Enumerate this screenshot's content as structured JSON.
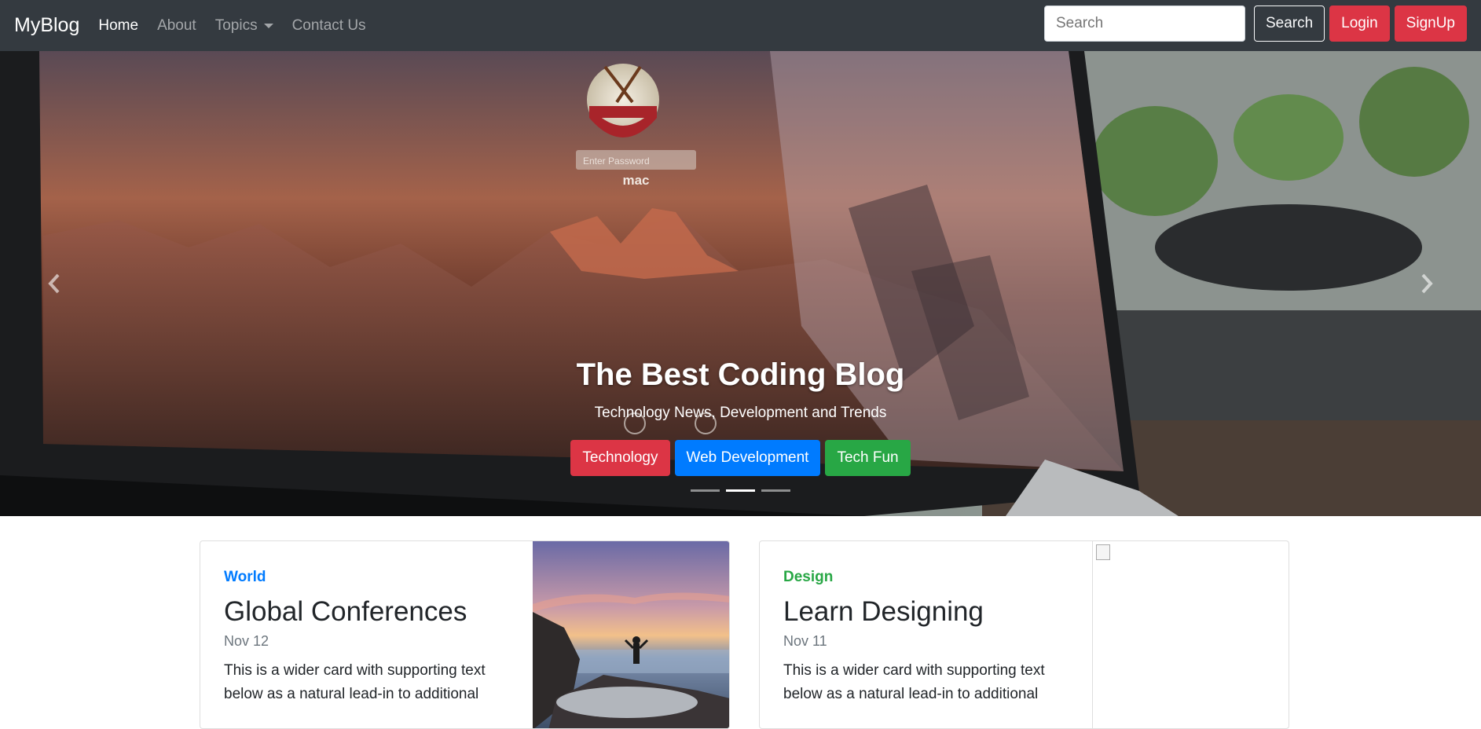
{
  "navbar": {
    "brand": "MyBlog",
    "links": [
      "Home",
      "About",
      "Topics",
      "Contact Us"
    ],
    "search_placeholder": "Search",
    "search_button": "Search",
    "login_button": "Login",
    "signup_button": "SignUp"
  },
  "hero": {
    "screen_user": "mac",
    "screen_password_placeholder": "Enter Password",
    "title": "The Best Coding Blog",
    "subtitle": "Technology News, Development and Trends",
    "buttons": [
      "Technology",
      "Web Development",
      "Tech Fun"
    ],
    "active_slide": 2,
    "slide_count": 3
  },
  "cards": [
    {
      "category": "World",
      "title": "Global Conferences",
      "date": "Nov 12",
      "text": "This is a wider card with supporting text below as a natural lead-in to additional"
    },
    {
      "category": "Design",
      "title": "Learn Designing",
      "date": "Nov 11",
      "text": "This is a wider card with supporting text below as a natural lead-in to additional"
    }
  ],
  "colors": {
    "navbar": "#343a40",
    "danger": "#dc3545",
    "primary": "#007bff",
    "success": "#28a745"
  }
}
